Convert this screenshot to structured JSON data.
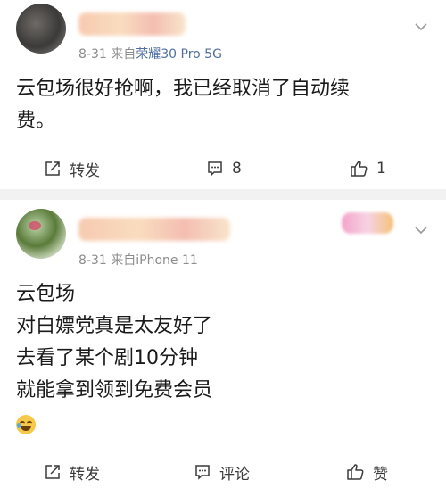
{
  "posts": [
    {
      "date": "8-31",
      "source_prefix": "来自",
      "device": "荣耀30 Pro 5G",
      "content_lines": [
        "云包场很好抢啊，我已经取消了自动续",
        "费。"
      ],
      "actions": {
        "share": "转发",
        "comment": "8",
        "like": "1"
      }
    },
    {
      "date": "8-31",
      "source_prefix": "来自",
      "device": "iPhone 11",
      "content_lines": [
        "云包场",
        "对白嫖党真是太友好了",
        "去看了某个剧10分钟",
        "就能拿到领到免费会员"
      ],
      "emoji": "laugh-cry-emoji",
      "actions": {
        "share": "转发",
        "comment": "评论",
        "like": "赞"
      }
    }
  ],
  "colors": {
    "accent_link": "#4f6f9e",
    "meta_gray": "#8c8c8c",
    "separator": "#f2f2f2"
  }
}
